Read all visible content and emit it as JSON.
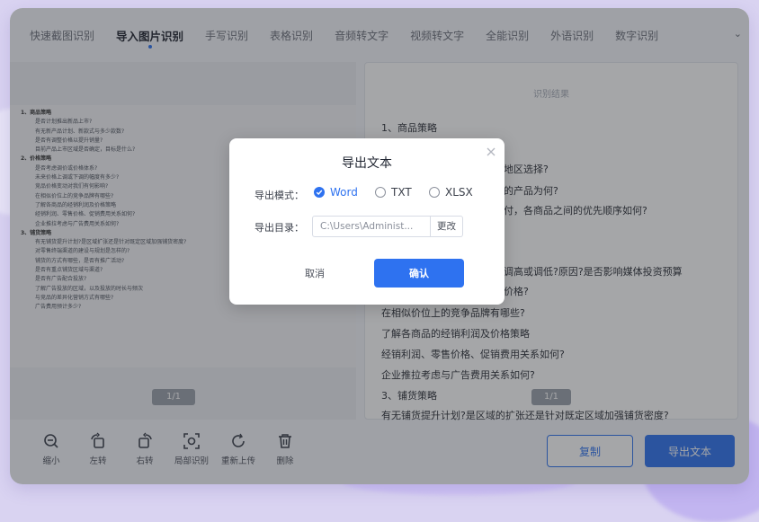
{
  "tabs": [
    {
      "label": "快速截图识别"
    },
    {
      "label": "导入图片识别"
    },
    {
      "label": "手写识别"
    },
    {
      "label": "表格识别"
    },
    {
      "label": "音频转文字"
    },
    {
      "label": "视频转文字"
    },
    {
      "label": "全能识别"
    },
    {
      "label": "外语识别"
    },
    {
      "label": "数字识别"
    }
  ],
  "tabs_more": "⌄",
  "active_tab": "导入图片识别",
  "doc": {
    "lines": [
      "1、商品策略",
      "是否计划推出新品上市?",
      "有无新产品计划、新款式与多少款数?",
      "是否有调整价格以提升销量?",
      "目前产品上市区域是否确定，目标是什么?",
      "2、价格策略",
      "是否考虑调价或价格体系?",
      "未来价格上调或下调的幅度有多少?",
      "竞品价格变动对我们有何影响?",
      "在相似价位上的竞争品牌有哪些?",
      "了解各商品的经销利润及价格策略",
      "经销利润、零售价格、促销费用关系如何?",
      "企业推拉考虑与广告费用关系如何?",
      "3、铺货策略",
      "有无铺货提升计划?是区域扩张还是针对既定区域加强铺货密度?",
      "对零售终端渠道的建设与规划是怎样的?",
      "铺货的方式有哪些，是否有推广活动?",
      "是否有重点铺货区域与渠道?",
      "是否有广告配合投放?",
      "了解广告投放的区域，以及投放的时长与频次",
      "与竞品的差异化营销方式有哪些?",
      "广告费用预计多少?"
    ],
    "page_indicator": "1/1"
  },
  "toolbar": [
    {
      "label": "缩小",
      "icon": "zoom-out-icon"
    },
    {
      "label": "左转",
      "icon": "rotate-left-icon"
    },
    {
      "label": "右转",
      "icon": "rotate-right-icon"
    },
    {
      "label": "局部识别",
      "icon": "partial-scan-icon"
    },
    {
      "label": "重新上传",
      "icon": "reupload-icon"
    },
    {
      "label": "删除",
      "icon": "trash-icon"
    }
  ],
  "result": {
    "title": "识别结果",
    "lines": [
      "1、商品策略",
      "地区选择?",
      "的产品为何?",
      "付，各商品之间的优先顺序如何?",
      "调高或调低?原因?是否影响媒体投资预算",
      "价格?",
      "在相似价位上的竞争品牌有哪些?",
      "了解各商品的经销利润及价格策略",
      "经销利润、零售价格、促销费用关系如何?",
      "企业推拉考虑与广告费用关系如何?",
      "3、铺货策略",
      "有无铺货提升计划?是区域的扩张还是针对既定区域加强铺货密度?"
    ],
    "page_indicator": "1/1"
  },
  "buttons": {
    "copy": "复制",
    "export": "导出文本"
  },
  "dialog": {
    "title": "导出文本",
    "mode_label": "导出模式：",
    "modes": [
      {
        "label": "Word",
        "checked": true
      },
      {
        "label": "TXT",
        "checked": false
      },
      {
        "label": "XLSX",
        "checked": false
      }
    ],
    "dir_label": "导出目录：",
    "dir_value": "C:\\Users\\Administ...",
    "dir_change": "更改",
    "cancel": "取消",
    "confirm": "确认",
    "close_icon": "close-icon"
  },
  "colors": {
    "accent": "#2e72f0",
    "window_bg": "#f4f6fb",
    "page_bg": "#d9d3f1"
  }
}
